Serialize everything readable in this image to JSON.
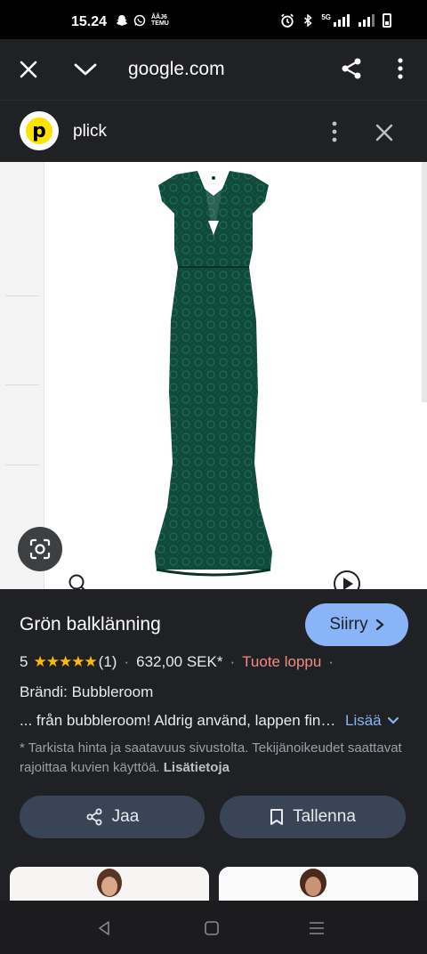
{
  "status_bar": {
    "time": "15.24",
    "temu_label": "ÅÅJ6 TEMU",
    "network_label": "5G"
  },
  "browser": {
    "url": "google.com",
    "icons": [
      "close-icon",
      "chevron-down-icon",
      "share-icon",
      "more-vert-icon"
    ]
  },
  "sheet": {
    "source_name": "plick",
    "source_logo_letter": "p"
  },
  "product": {
    "title": "Grön balklänning",
    "goto_label": "Siirry",
    "rating_value": "5",
    "stars": "★★★★★",
    "review_count": "(1)",
    "price": "632,00 SEK*",
    "availability": "Tuote loppu",
    "brand": "Brändi: Bubbleroom",
    "description": "... från bubbleroom! Aldrig använd, lappen finns kvar",
    "more_label": "Lisää",
    "disclaimer": "* Tarkista hinta ja saatavuus sivustolta. Tekijänoikeudet saattavat rajoittaa kuvien käyttöä.",
    "disclaimer_link": "Lisätietoja",
    "share_label": "Jaa",
    "save_label": "Tallenna"
  },
  "colors": {
    "background": "#202124",
    "accent": "#8ab4f8",
    "button": "#394457",
    "star": "#fbbc04",
    "out_of_stock": "#f28b82",
    "dress": "#0f4a3a"
  }
}
